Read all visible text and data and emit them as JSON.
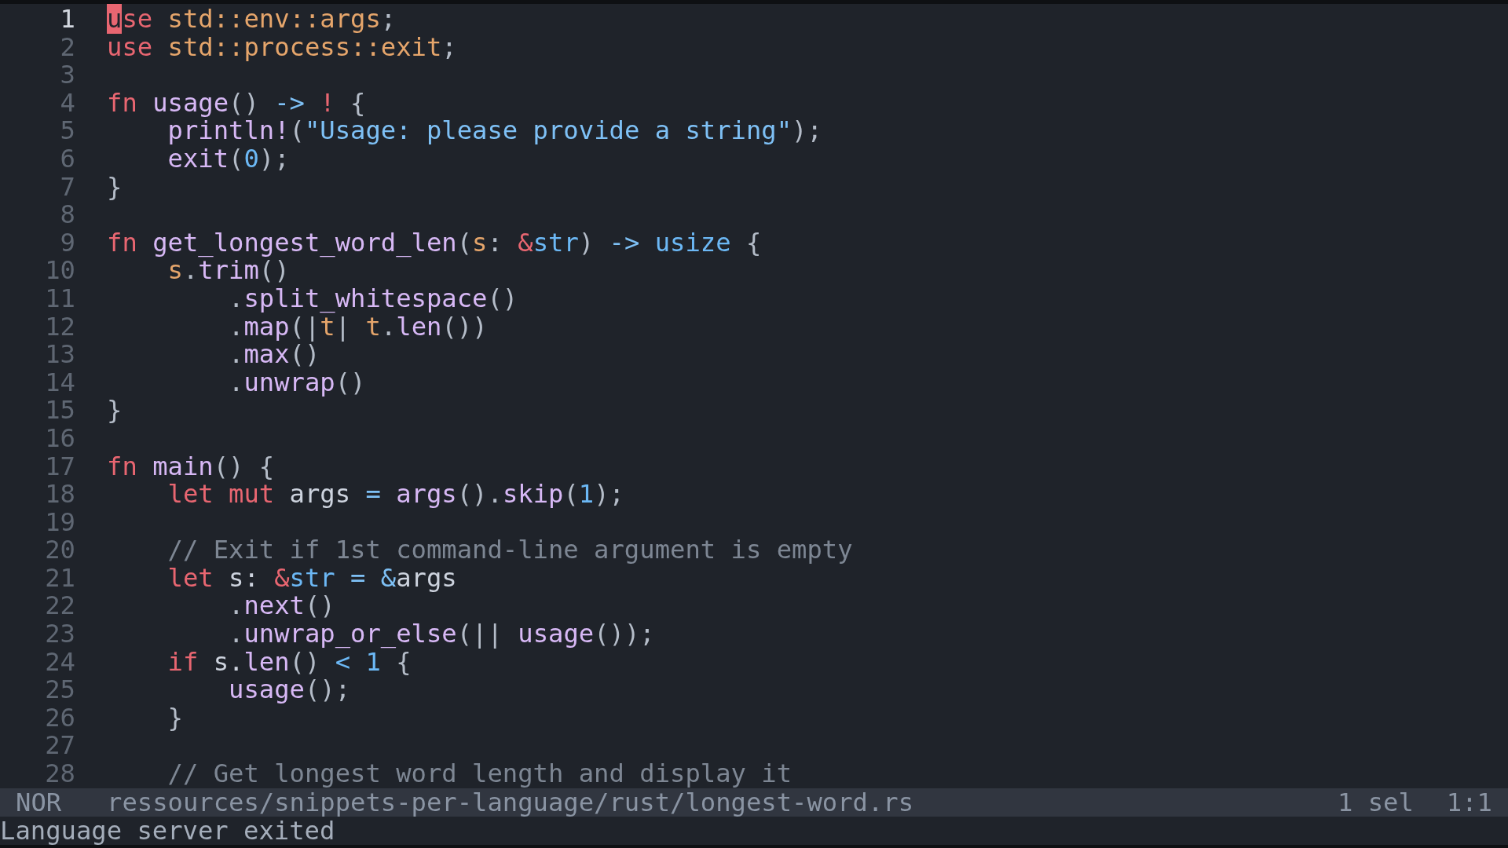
{
  "editor": {
    "lines": [
      {
        "number": "1",
        "current": true,
        "tokens": [
          {
            "text": "u",
            "kind": "keyword",
            "cursor": true
          },
          {
            "text": "se ",
            "kind": "keyword"
          },
          {
            "text": "std::env::args",
            "kind": "module"
          },
          {
            "text": ";",
            "kind": "punct"
          }
        ]
      },
      {
        "number": "2",
        "current": false,
        "tokens": [
          {
            "text": "use ",
            "kind": "keyword"
          },
          {
            "text": "std::process::exit",
            "kind": "module"
          },
          {
            "text": ";",
            "kind": "punct"
          }
        ]
      },
      {
        "number": "3",
        "current": false
      },
      {
        "number": "4",
        "current": false,
        "tokens": [
          {
            "text": "fn ",
            "kind": "keyword"
          },
          {
            "text": "usage",
            "kind": "function"
          },
          {
            "text": "() ",
            "kind": "punct"
          },
          {
            "text": "-> ",
            "kind": "operator"
          },
          {
            "text": "!",
            "kind": "keyword"
          },
          {
            "text": " {",
            "kind": "punct"
          }
        ]
      },
      {
        "number": "5",
        "current": false,
        "tokens": [
          {
            "text": "    println!",
            "kind": "function"
          },
          {
            "text": "(",
            "kind": "punct"
          },
          {
            "text": "\"Usage: please provide a string\"",
            "kind": "string"
          },
          {
            "text": ");",
            "kind": "punct"
          }
        ]
      },
      {
        "number": "6",
        "current": false,
        "tokens": [
          {
            "text": "    exit",
            "kind": "function"
          },
          {
            "text": "(",
            "kind": "punct"
          },
          {
            "text": "0",
            "kind": "number"
          },
          {
            "text": ");",
            "kind": "punct"
          }
        ]
      },
      {
        "number": "7",
        "current": false,
        "tokens": [
          {
            "text": "}",
            "kind": "punct"
          }
        ]
      },
      {
        "number": "8",
        "current": false
      },
      {
        "number": "9",
        "current": false,
        "tokens": [
          {
            "text": "fn ",
            "kind": "keyword"
          },
          {
            "text": "get_longest_word_len",
            "kind": "function"
          },
          {
            "text": "(",
            "kind": "punct"
          },
          {
            "text": "s",
            "kind": "param"
          },
          {
            "text": ": ",
            "kind": "punct"
          },
          {
            "text": "&",
            "kind": "keyword"
          },
          {
            "text": "str",
            "kind": "type"
          },
          {
            "text": ") ",
            "kind": "punct"
          },
          {
            "text": "-> ",
            "kind": "operator"
          },
          {
            "text": "usize",
            "kind": "type"
          },
          {
            "text": " {",
            "kind": "punct"
          }
        ]
      },
      {
        "number": "10",
        "current": false,
        "tokens": [
          {
            "text": "    s",
            "kind": "param"
          },
          {
            "text": ".",
            "kind": "punct"
          },
          {
            "text": "trim",
            "kind": "function"
          },
          {
            "text": "()",
            "kind": "punct"
          }
        ]
      },
      {
        "number": "11",
        "current": false,
        "tokens": [
          {
            "text": "        .",
            "kind": "punct"
          },
          {
            "text": "split_whitespace",
            "kind": "function"
          },
          {
            "text": "()",
            "kind": "punct"
          }
        ]
      },
      {
        "number": "12",
        "current": false,
        "tokens": [
          {
            "text": "        .",
            "kind": "punct"
          },
          {
            "text": "map",
            "kind": "function"
          },
          {
            "text": "(|",
            "kind": "punct"
          },
          {
            "text": "t",
            "kind": "param"
          },
          {
            "text": "| ",
            "kind": "punct"
          },
          {
            "text": "t",
            "kind": "param"
          },
          {
            "text": ".",
            "kind": "punct"
          },
          {
            "text": "len",
            "kind": "function"
          },
          {
            "text": "())",
            "kind": "punct"
          }
        ]
      },
      {
        "number": "13",
        "current": false,
        "tokens": [
          {
            "text": "        .",
            "kind": "punct"
          },
          {
            "text": "max",
            "kind": "function"
          },
          {
            "text": "()",
            "kind": "punct"
          }
        ]
      },
      {
        "number": "14",
        "current": false,
        "tokens": [
          {
            "text": "        .",
            "kind": "punct"
          },
          {
            "text": "unwrap",
            "kind": "function"
          },
          {
            "text": "()",
            "kind": "punct"
          }
        ]
      },
      {
        "number": "15",
        "current": false,
        "tokens": [
          {
            "text": "}",
            "kind": "punct"
          }
        ]
      },
      {
        "number": "16",
        "current": false
      },
      {
        "number": "17",
        "current": false,
        "tokens": [
          {
            "text": "fn ",
            "kind": "keyword"
          },
          {
            "text": "main",
            "kind": "function"
          },
          {
            "text": "() {",
            "kind": "punct"
          }
        ]
      },
      {
        "number": "18",
        "current": false,
        "tokens": [
          {
            "text": "    let mut",
            "kind": "keyword"
          },
          {
            "text": " args ",
            "kind": "plain"
          },
          {
            "text": "= ",
            "kind": "operator"
          },
          {
            "text": "args",
            "kind": "function"
          },
          {
            "text": "().",
            "kind": "punct"
          },
          {
            "text": "skip",
            "kind": "function"
          },
          {
            "text": "(",
            "kind": "punct"
          },
          {
            "text": "1",
            "kind": "number"
          },
          {
            "text": ");",
            "kind": "punct"
          }
        ]
      },
      {
        "number": "19",
        "current": false
      },
      {
        "number": "20",
        "current": false,
        "tokens": [
          {
            "text": "    // Exit if 1st command-line argument is empty",
            "kind": "comment"
          }
        ]
      },
      {
        "number": "21",
        "current": false,
        "tokens": [
          {
            "text": "    let",
            "kind": "keyword"
          },
          {
            "text": " s: ",
            "kind": "plain"
          },
          {
            "text": "&",
            "kind": "keyword"
          },
          {
            "text": "str",
            "kind": "type"
          },
          {
            "text": " = &",
            "kind": "operator"
          },
          {
            "text": "args",
            "kind": "plain"
          }
        ]
      },
      {
        "number": "22",
        "current": false,
        "tokens": [
          {
            "text": "        .",
            "kind": "punct"
          },
          {
            "text": "next",
            "kind": "function"
          },
          {
            "text": "()",
            "kind": "punct"
          }
        ]
      },
      {
        "number": "23",
        "current": false,
        "tokens": [
          {
            "text": "        .",
            "kind": "punct"
          },
          {
            "text": "unwrap_or_else",
            "kind": "function"
          },
          {
            "text": "(|| ",
            "kind": "punct"
          },
          {
            "text": "usage",
            "kind": "function"
          },
          {
            "text": "());",
            "kind": "punct"
          }
        ]
      },
      {
        "number": "24",
        "current": false,
        "tokens": [
          {
            "text": "    if",
            "kind": "keyword"
          },
          {
            "text": " s.",
            "kind": "plain"
          },
          {
            "text": "len",
            "kind": "function"
          },
          {
            "text": "() ",
            "kind": "punct"
          },
          {
            "text": "< 1",
            "kind": "number"
          },
          {
            "text": " {",
            "kind": "punct"
          }
        ]
      },
      {
        "number": "25",
        "current": false,
        "tokens": [
          {
            "text": "        usage",
            "kind": "function"
          },
          {
            "text": "();",
            "kind": "punct"
          }
        ]
      },
      {
        "number": "26",
        "current": false,
        "tokens": [
          {
            "text": "    }",
            "kind": "punct"
          }
        ]
      },
      {
        "number": "27",
        "current": false
      },
      {
        "number": "28",
        "current": false,
        "tokens": [
          {
            "text": "    // Get longest word length and display it",
            "kind": "comment"
          }
        ]
      }
    ]
  },
  "status_bar": {
    "mode": "NOR",
    "file_path": "ressources/snippets-per-language/rust/longest-word.rs",
    "selections": "1 sel",
    "position": "1:1"
  },
  "message": "Language server exited"
}
